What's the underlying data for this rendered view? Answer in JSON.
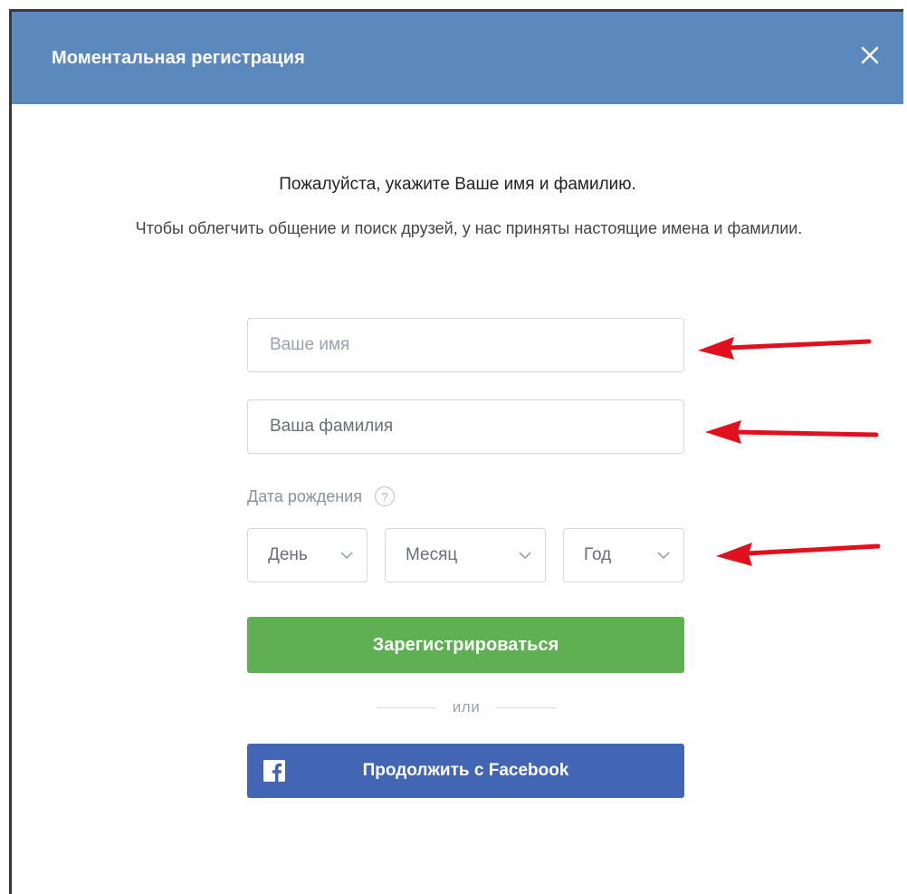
{
  "dialog": {
    "title": "Моментальная регистрация",
    "close_icon": "close-icon"
  },
  "intro": {
    "heading": "Пожалуйста, укажите Ваше имя и фамилию.",
    "hint": "Чтобы облегчить общение и поиск друзей, у нас приняты настоящие имена и фамилии."
  },
  "form": {
    "first_name": {
      "value": "",
      "placeholder": "Ваше имя"
    },
    "last_name": {
      "value": "",
      "placeholder": "Ваша фамилия"
    },
    "birthdate": {
      "label": "Дата рождения",
      "help_icon": "?",
      "day": "День",
      "month": "Месяц",
      "year": "Год"
    },
    "register_label": "Зарегистрироваться",
    "or_label": "или",
    "facebook_label": "Продолжить с Facebook"
  },
  "colors": {
    "header": "#5b88bd",
    "register": "#5fb053",
    "facebook": "#4366b4",
    "annotation_arrow": "#e0101e"
  },
  "annotations": {
    "arrow_icon": "red-arrow-left-icon"
  }
}
